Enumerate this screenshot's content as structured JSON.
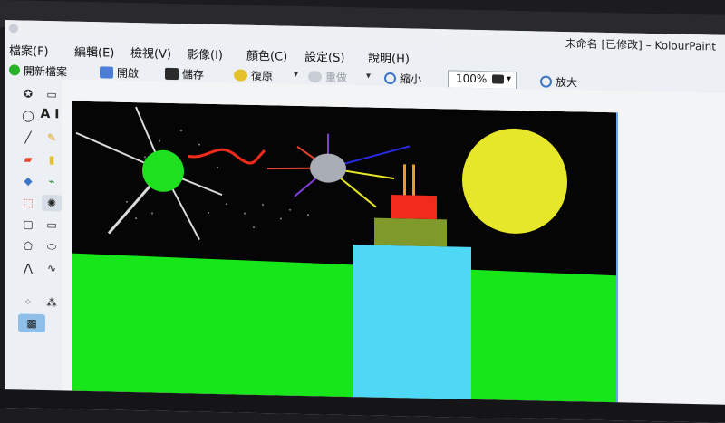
{
  "window": {
    "title": "未命名 [已修改] – KolourPaint"
  },
  "menu": [
    {
      "label": "檔案(F)"
    },
    {
      "label": "編輯(E)"
    },
    {
      "label": "檢視(V)"
    },
    {
      "label": "影像(I)"
    },
    {
      "label": "顏色(C)"
    },
    {
      "label": "設定(S)"
    },
    {
      "label": "說明(H)"
    }
  ],
  "toolbar": {
    "new_label": "開新檔案",
    "open_label": "開啟",
    "save_label": "儲存",
    "undo_label": "復原",
    "redo_label": "重做",
    "zoom_out_label": "縮小",
    "zoom_value": "100%",
    "zoom_in_label": "放大"
  },
  "tools": {
    "text_tool_label": "A I"
  },
  "colors": {
    "canvas_bg": "#050505",
    "ground": "#17e61a",
    "river": "#4fd8f5",
    "sun_yellow": "#e6e62a",
    "left_sun": "#1fe01f",
    "moon_gray": "#a9adb5",
    "red_block": "#f02b1b",
    "olive_block": "#7f9a2a",
    "candle": "#e6a21a"
  }
}
